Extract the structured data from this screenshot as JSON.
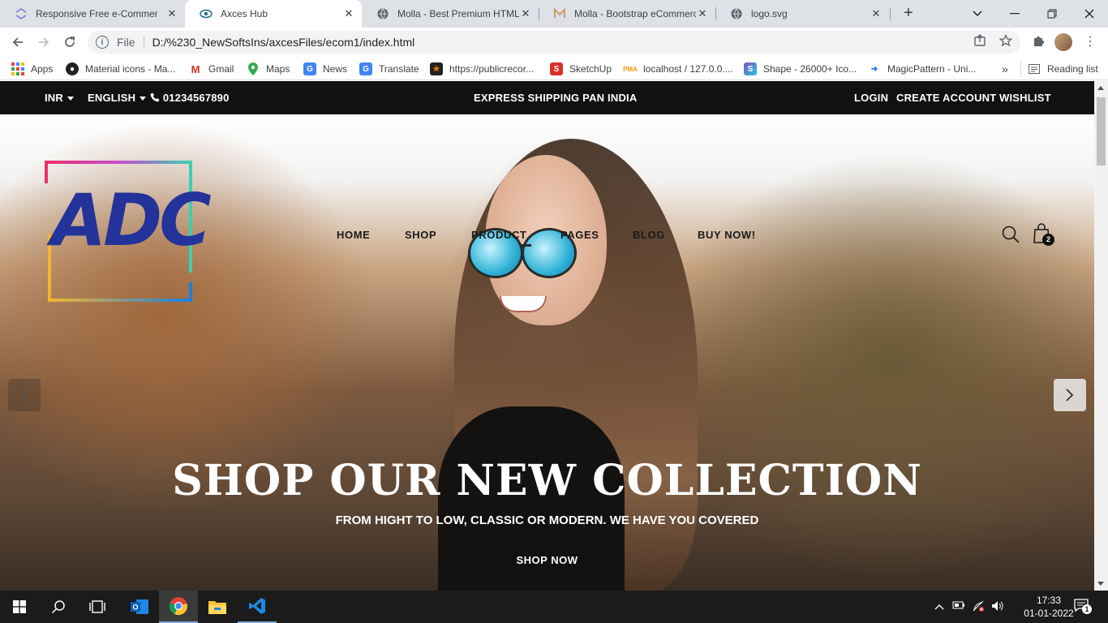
{
  "browser": {
    "tabs": [
      {
        "title": "Responsive Free e-Commerce",
        "favicon": "arrows-icon",
        "active": false
      },
      {
        "title": "Axces Hub",
        "favicon": "eye-icon",
        "active": true
      },
      {
        "title": "Molla - Best Premium HTML",
        "favicon": "globe-icon",
        "active": false
      },
      {
        "title": "Molla - Bootstrap eCommerce",
        "favicon": "m-icon",
        "active": false
      },
      {
        "title": "logo.svg",
        "favicon": "globe-icon",
        "active": false
      }
    ],
    "address": {
      "scheme": "File",
      "url": "D:/%230_NewSoftsIns/axcesFiles/ecom1/index.html"
    },
    "bookmarks": [
      {
        "label": "Apps",
        "icon": "apps-grid-icon"
      },
      {
        "label": "Material icons - Ma...",
        "icon": "github-icon",
        "color": "#222222"
      },
      {
        "label": "Gmail",
        "icon": "gmail-icon",
        "color": "#d93025"
      },
      {
        "label": "Maps",
        "icon": "maps-pin-icon",
        "color": "#34a853"
      },
      {
        "label": "News",
        "icon": "news-icon",
        "color": "#4285f4"
      },
      {
        "label": "Translate",
        "icon": "translate-icon",
        "color": "#4285f4"
      },
      {
        "label": "https://publicrecor...",
        "icon": "star-badge-icon",
        "color": "#e8710a"
      },
      {
        "label": "SketchUp",
        "icon": "sketchup-icon",
        "color": "#d93025"
      },
      {
        "label": "localhost / 127.0.0....",
        "icon": "pma-icon",
        "color": "#f29900"
      },
      {
        "label": "Shape - 26000+ Ico...",
        "icon": "shape-icon",
        "color": "#7e57c2"
      },
      {
        "label": "MagicPattern - Uni...",
        "icon": "magicpattern-icon",
        "color": "#1a73e8"
      }
    ],
    "reading_list": "Reading list",
    "more_bookmarks": "»"
  },
  "site": {
    "topbar": {
      "currency": "INR",
      "language": "ENGLISH",
      "phone": "01234567890",
      "announcement": "EXPRESS SHIPPING PAN INDIA",
      "login": "LOGIN",
      "create_account": "CREATE ACCOUNT",
      "wishlist": "WISHLIST"
    },
    "logo_text": "ADC",
    "nav": [
      "HOME",
      "SHOP",
      "PRODUCT",
      "PAGES",
      "BLOG",
      "BUY NOW!"
    ],
    "cart_count": "2",
    "hero": {
      "headline": "SHOP OUR NEW COLLECTION",
      "subline": "FROM HIGHT TO LOW, CLASSIC OR MODERN. WE HAVE YOU COVERED",
      "cta": "SHOP NOW"
    }
  },
  "taskbar": {
    "time": "17:33",
    "date": "01-01-2022",
    "notification_count": "1"
  }
}
